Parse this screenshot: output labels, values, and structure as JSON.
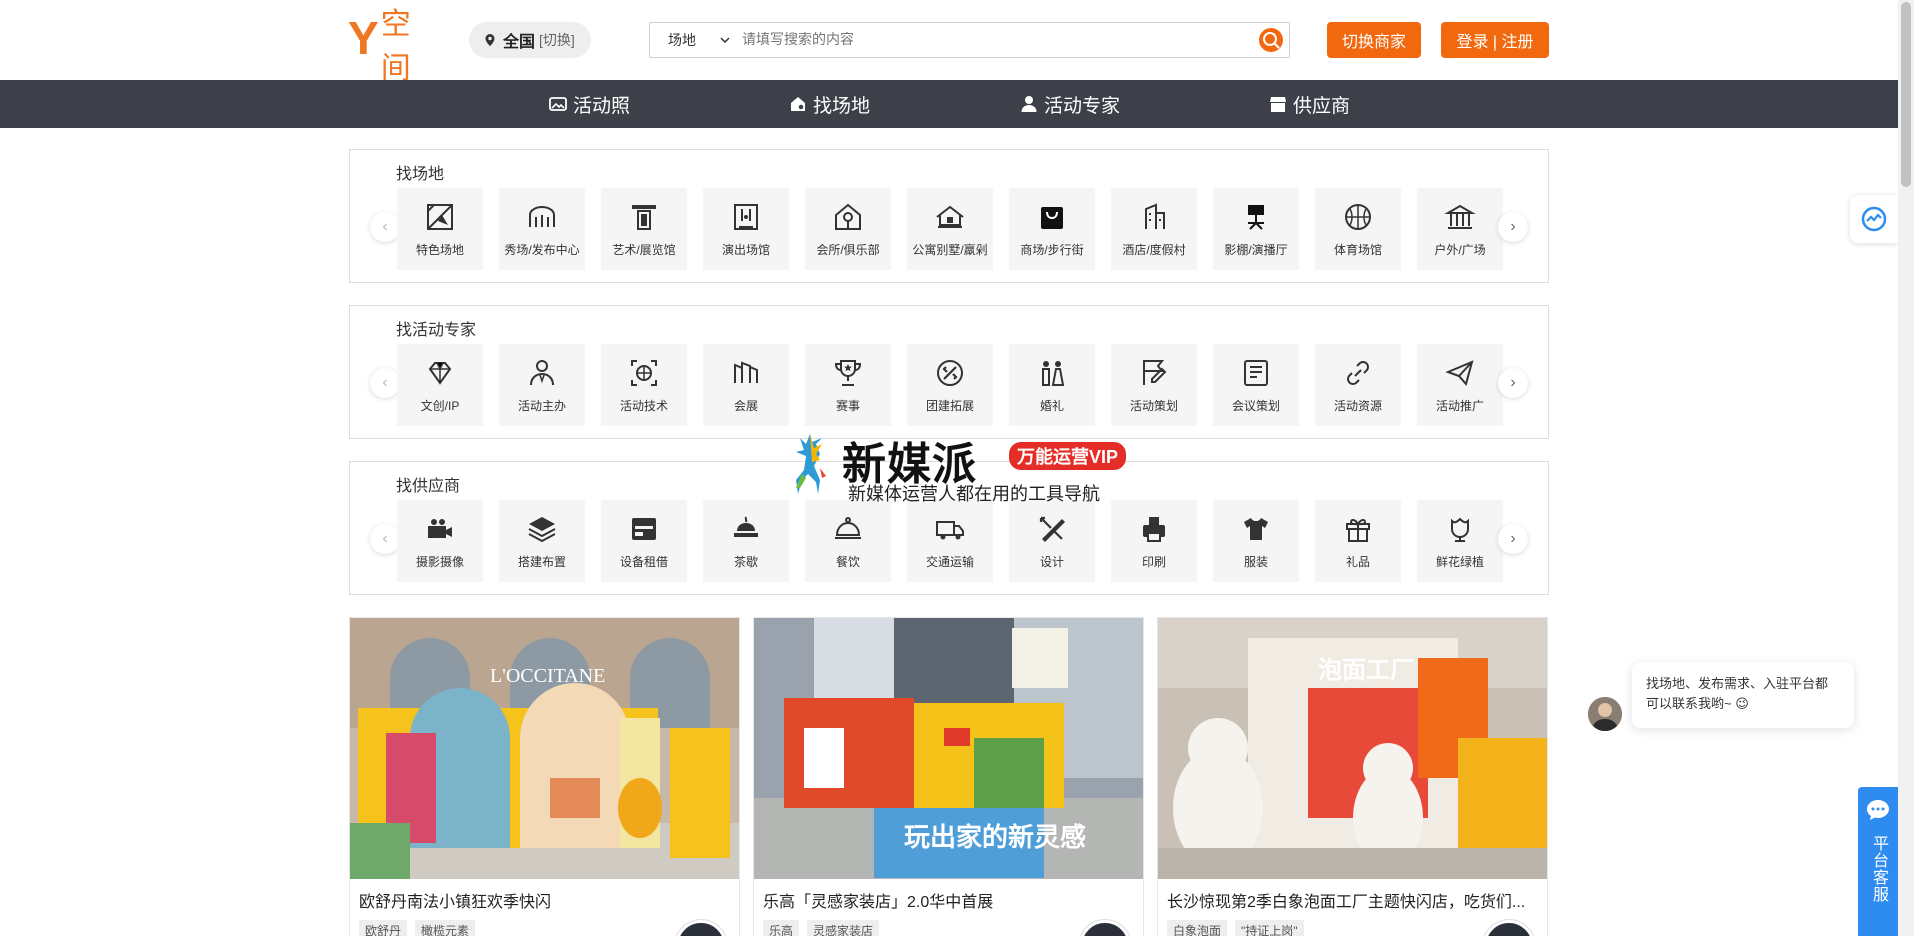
{
  "header": {
    "logo_y": "Y",
    "logo_text": "空间",
    "city": "全国",
    "city_switch": "[切换]",
    "search_type": "场地",
    "search_placeholder": "请填写搜索的内容",
    "merchant_button": "切换商家",
    "login_button": "登录 | 注册"
  },
  "nav": {
    "items": [
      {
        "label": "活动照",
        "icon": "photo-icon"
      },
      {
        "label": "找场地",
        "icon": "venue-icon"
      },
      {
        "label": "活动专家",
        "icon": "person-icon"
      },
      {
        "label": "供应商",
        "icon": "store-icon"
      }
    ]
  },
  "venues": {
    "title": "找场地",
    "items": [
      "特色场地",
      "秀场/发布中心",
      "艺术/展览馆",
      "演出场馆",
      "会所/俱乐部",
      "公寓别墅/羸剁",
      "商场/步行街",
      "酒店/度假村",
      "影棚/演播厅",
      "体育场馆",
      "户外/广场"
    ]
  },
  "experts": {
    "title": "找活动专家",
    "items": [
      "文创/IP",
      "活动主办",
      "活动技术",
      "会展",
      "赛事",
      "团建拓展",
      "婚礼",
      "活动策划",
      "会议策划",
      "活动资源",
      "活动推广"
    ]
  },
  "suppliers": {
    "title": "找供应商",
    "items": [
      "摄影摄像",
      "搭建布置",
      "设备租借",
      "茶歇",
      "餐饮",
      "交通运输",
      "设计",
      "印刷",
      "服装",
      "礼品",
      "鲜花绿植"
    ]
  },
  "watermark": {
    "brand": "新媒派",
    "badge": "万能运营VIP",
    "subtitle": "新媒体运营人都在用的工具导航"
  },
  "cards": [
    {
      "title": "欧舒丹南法小镇狂欢季快闪",
      "tags": [
        "欧舒丹",
        "橄榄元素"
      ],
      "image_text": "L'OCCITANE"
    },
    {
      "title": "乐高「灵感家装店」2.0华中首展",
      "tags": [
        "乐高",
        "灵感家装店"
      ],
      "image_text": "玩出家的新灵感"
    },
    {
      "title": "长沙惊现第2季白象泡面工厂主题快闪店，吃货们...",
      "tags": [
        "白象泡面",
        "\"持证上岗\""
      ],
      "image_text": "泡面工厂"
    }
  ],
  "chat": {
    "message": "找场地、发布需求、入驻平台都可以联系我哟~ 😉"
  },
  "service": {
    "label": "平台客服"
  },
  "colors": {
    "brand": "#f2680f",
    "nav_bg": "#3d4048",
    "service_blue": "#2e8cf0"
  }
}
